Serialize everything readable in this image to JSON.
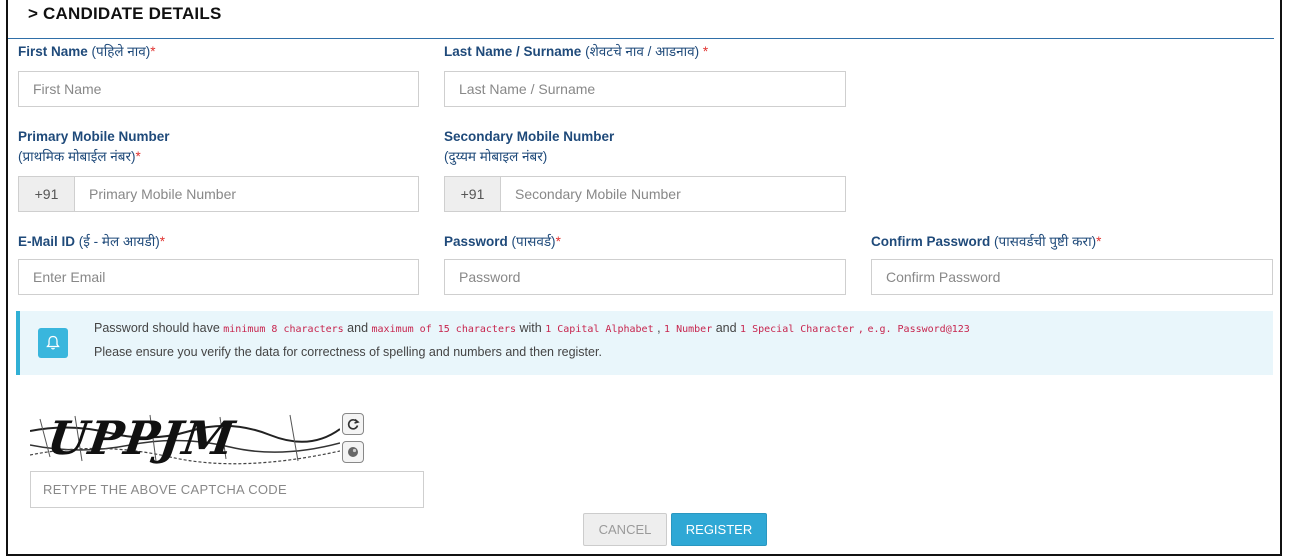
{
  "section": {
    "title": "> CANDIDATE DETAILS"
  },
  "fields": {
    "first_name": {
      "label_en": "First Name",
      "label_mr": "(पहिले नाव)",
      "required": "*",
      "placeholder": "First Name"
    },
    "last_name": {
      "label_en": "Last Name / Surname",
      "label_mr": "(शेवटचे नाव / आडनाव)",
      "required": "*",
      "placeholder": "Last Name / Surname"
    },
    "primary_mobile": {
      "label_en": "Primary Mobile Number",
      "label_mr": "(प्राथमिक मोबाईल नंबर)",
      "required": "*",
      "prefix": "+91",
      "placeholder": "Primary Mobile Number"
    },
    "secondary_mobile": {
      "label_en": "Secondary Mobile Number",
      "label_mr": "(दुय्यम मोबाइल नंबर)",
      "prefix": "+91",
      "placeholder": "Secondary Mobile Number"
    },
    "email": {
      "label_en": "E-Mail ID",
      "label_mr": "(ई - मेल आयडी)",
      "required": "*",
      "placeholder": "Enter Email"
    },
    "password": {
      "label_en": "Password",
      "label_mr": "(पासवर्ड)",
      "required": "*",
      "placeholder": "Password"
    },
    "confirm_password": {
      "label_en": "Confirm Password",
      "label_mr": "(पासवर्डची पुष्टी करा)",
      "required": "*",
      "placeholder": "Confirm Password"
    }
  },
  "info": {
    "icon": "bell-icon",
    "t1": "Password should have",
    "c1": "minimum 8 characters",
    "t2": "and",
    "c2": "maximum of 15 characters",
    "t3": "with",
    "c3": "1 Capital Alphabet",
    "t4": ",",
    "c4": "1 Number",
    "t5": "and",
    "c5": "1 Special Character",
    "t6": ",",
    "c6": "e.g. Password@123",
    "line2": "Please ensure you verify the data for correctness of spelling and numbers and then register."
  },
  "captcha": {
    "text": "UPPJM",
    "refresh_icon": "refresh-icon",
    "audio_icon": "audio-icon",
    "placeholder": "RETYPE THE ABOVE CAPTCHA CODE"
  },
  "buttons": {
    "cancel": "CANCEL",
    "register": "REGISTER"
  },
  "colors": {
    "label": "#1f4a7a",
    "required": "#e0322f",
    "accent": "#2fa8d5",
    "info_bg": "#e9f6fb",
    "code": "#c7254e"
  }
}
